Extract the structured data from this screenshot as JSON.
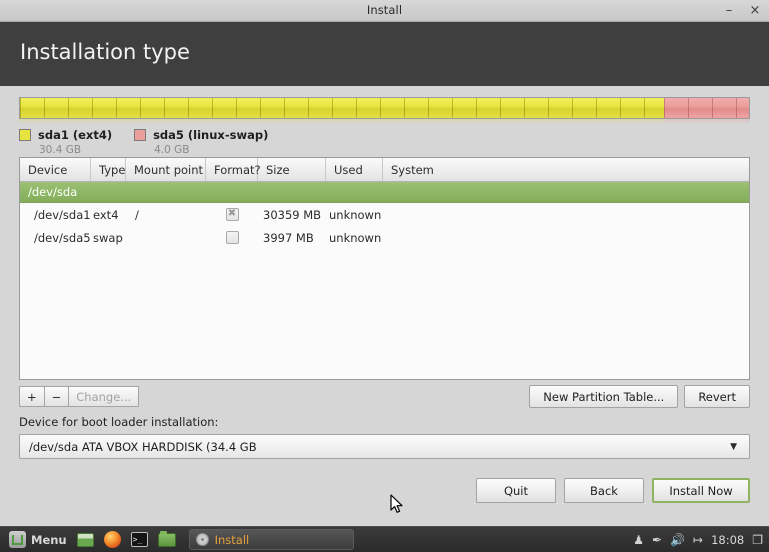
{
  "window": {
    "title": "Install",
    "minimize_icon": "minimize-icon",
    "minimize_glyph": "–",
    "close_icon": "close-icon",
    "close_glyph": "×"
  },
  "header": {
    "page_title": "Installation type"
  },
  "partition_bar": {
    "segments": [
      {
        "name": "sda1",
        "kind": "ext4",
        "percent": 88.4,
        "color": "#e8e43f"
      },
      {
        "name": "sda5",
        "kind": "swap",
        "percent": 11.6,
        "color": "#ec9e9d"
      }
    ]
  },
  "legend": [
    {
      "label": "sda1 (ext4)",
      "size": "30.4 GB",
      "color": "#e8e43f"
    },
    {
      "label": "sda5 (linux-swap)",
      "size": "4.0 GB",
      "color": "#ec9e9d"
    }
  ],
  "table": {
    "columns": [
      "Device",
      "Type",
      "Mount point",
      "Format?",
      "Size",
      "Used",
      "System"
    ],
    "group_row": "/dev/sda",
    "rows": [
      {
        "device": "/dev/sda1",
        "type": "ext4",
        "mount_point": "/",
        "format": true,
        "size": "30359 MB",
        "used": "unknown",
        "system": ""
      },
      {
        "device": "/dev/sda5",
        "type": "swap",
        "mount_point": "",
        "format": false,
        "size": "3997 MB",
        "used": "unknown",
        "system": ""
      }
    ]
  },
  "partition_tools": {
    "add_label": "+",
    "remove_label": "−",
    "change_label": "Change...",
    "new_partition_table_label": "New Partition Table...",
    "revert_label": "Revert"
  },
  "bootloader": {
    "label": "Device for boot loader installation:",
    "selected": "/dev/sda   ATA VBOX HARDDISK (34.4 GB",
    "arrow_glyph": "▼"
  },
  "nav_buttons": {
    "quit": "Quit",
    "back": "Back",
    "install_now": "Install Now",
    "primary_border_color": "#8fb264"
  },
  "taskbar": {
    "menu_label": "Menu",
    "launchers": [
      {
        "icon": "show-desktop-icon"
      },
      {
        "icon": "firefox-icon"
      },
      {
        "icon": "terminal-icon",
        "glyph": ">_"
      },
      {
        "icon": "file-manager-icon"
      }
    ],
    "window_button": {
      "label": "Install",
      "icon": "disc-icon"
    },
    "tray": [
      {
        "icon": "user-icon",
        "glyph": "♟"
      },
      {
        "icon": "brush-icon",
        "glyph": "✒"
      },
      {
        "icon": "volume-icon",
        "glyph": "🔊"
      },
      {
        "icon": "logout-icon",
        "glyph": "↦"
      }
    ],
    "clock": "18:08",
    "workspace_icon": "window-switcher-icon",
    "workspace_glyph": "❐"
  }
}
